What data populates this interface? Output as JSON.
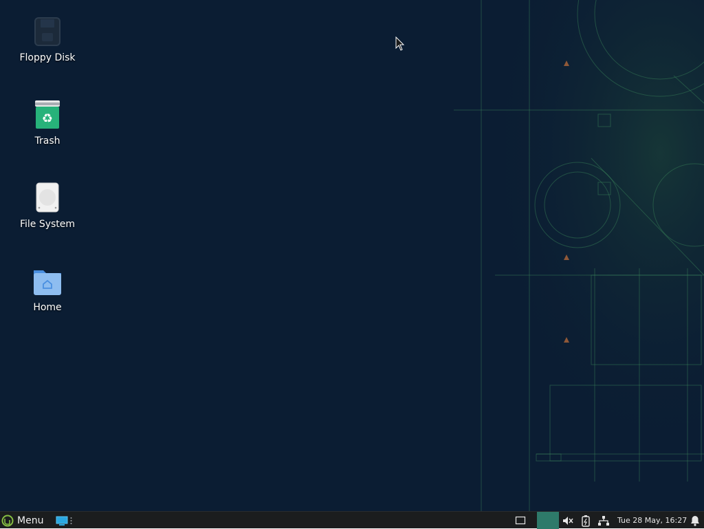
{
  "desktop": {
    "icons": [
      {
        "label": "Floppy Disk",
        "icon": "floppy-disk-icon"
      },
      {
        "label": "Trash",
        "icon": "trash-icon"
      },
      {
        "label": "File System",
        "icon": "hard-drive-icon"
      },
      {
        "label": "Home",
        "icon": "home-folder-icon"
      }
    ]
  },
  "taskbar": {
    "menu_label": "Menu",
    "clock": "Tue 28 May, 16:27"
  },
  "colors": {
    "background": "#0b1d33",
    "accent": "#2e7a6a",
    "taskbar": "#1b1d1e"
  }
}
